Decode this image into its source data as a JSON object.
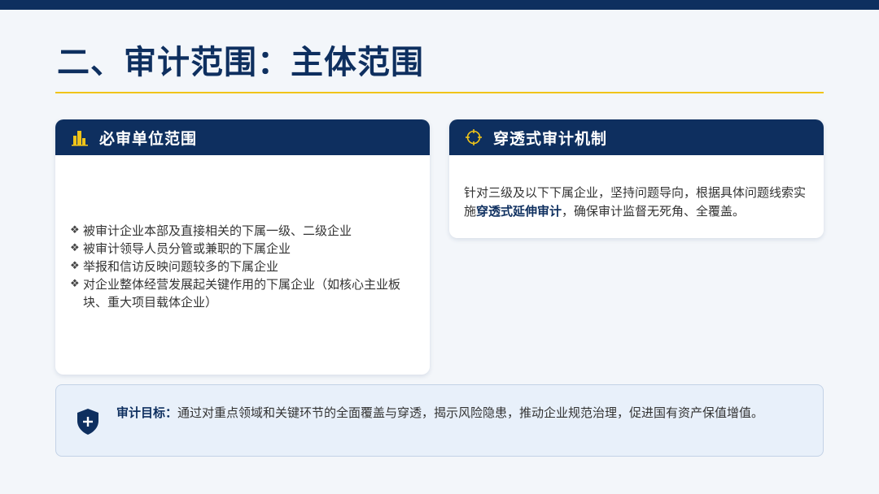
{
  "page": {
    "title": "二、审计范围：主体范围"
  },
  "colors": {
    "navy": "#0e2f5f",
    "gold": "#f0c419",
    "goal_bg": "#e8f0fa"
  },
  "left_card": {
    "icon": "buildings-icon",
    "header": "必审单位范围",
    "bullet_mark": "❖",
    "items": [
      "被审计企业本部及直接相关的下属一级、二级企业",
      "被审计领导人员分管或兼职的下属企业",
      "举报和信访反映问题较多的下属企业",
      "对企业整体经营发展起关键作用的下属企业（如核心主业板块、重大项目载体企业）"
    ]
  },
  "right_card": {
    "icon": "crosshair-icon",
    "header": "穿透式审计机制",
    "text_before": "针对三级及以下下属企业，坚持问题导向，根据具体问题线索实施",
    "text_highlight": "穿透式延伸审计",
    "text_after": "，确保审计监督无死角、全覆盖。"
  },
  "goal": {
    "icon": "shield-plus-icon",
    "label": "审计目标：",
    "text": "通过对重点领域和关键环节的全面覆盖与穿透，揭示风险隐患，推动企业规范治理，促进国有资产保值增值。"
  }
}
